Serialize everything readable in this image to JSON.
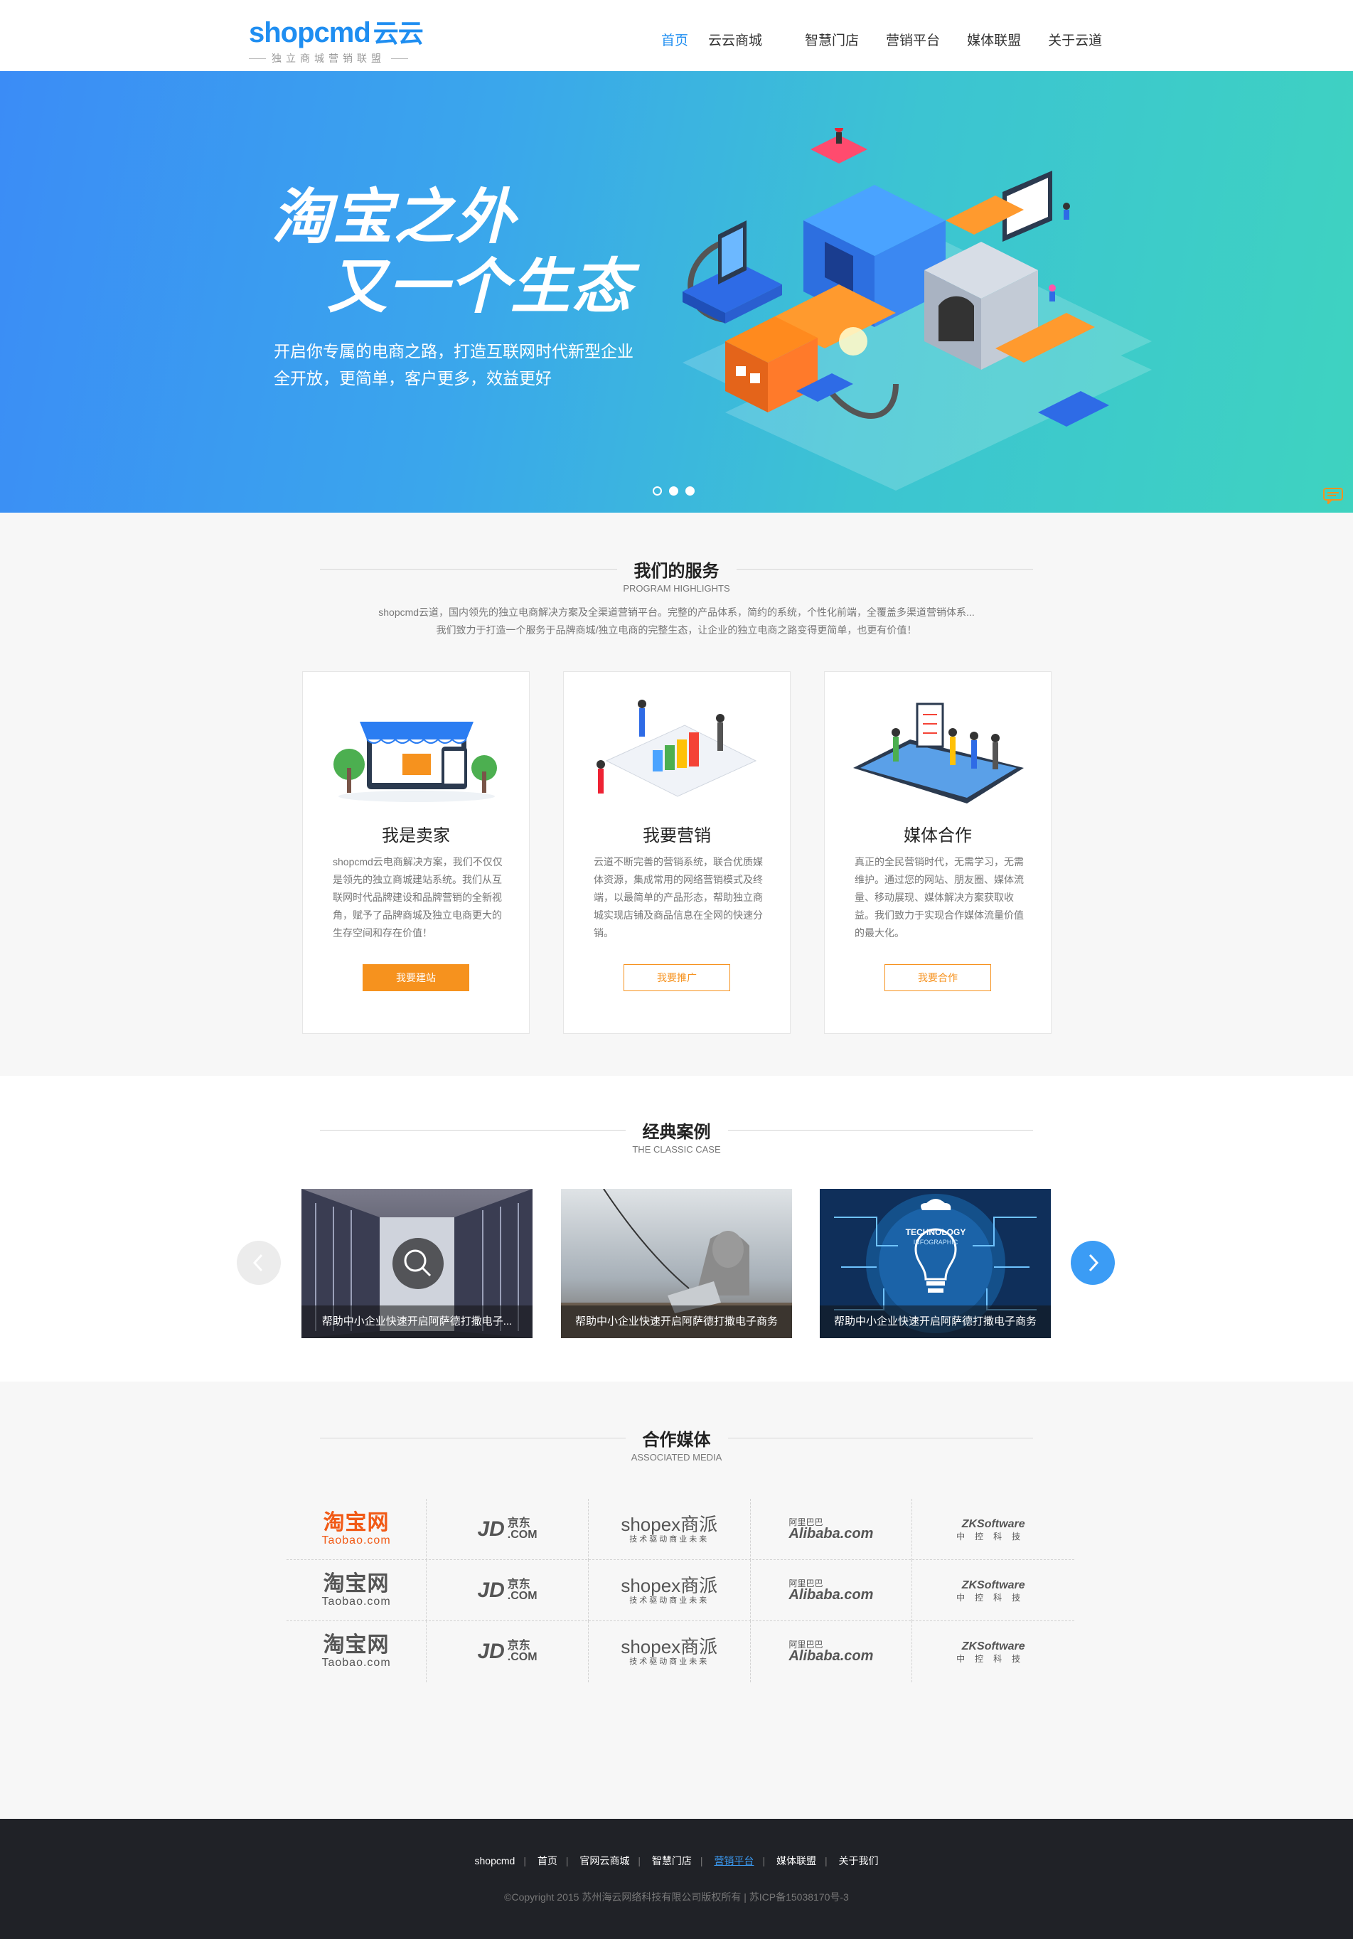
{
  "header": {
    "logo_text": "shopcmd",
    "logo_cn": "云云",
    "logo_tagline": "独立商城营销联盟",
    "nav": [
      {
        "label": "首页",
        "active": true
      },
      {
        "label": "云云商城",
        "active": false
      },
      {
        "label": "智慧门店",
        "active": false
      },
      {
        "label": "营销平台",
        "active": false
      },
      {
        "label": "媒体联盟",
        "active": false
      },
      {
        "label": "关于云道",
        "active": false
      }
    ]
  },
  "banner": {
    "title_line1": "淘宝之外",
    "title_line2": "又一个生态",
    "sub_line1": "开启你专属的电商之路，打造互联网时代新型企业",
    "sub_line2": "全开放，更简单，客户更多，效益更好",
    "slides": 3,
    "active_slide": 2
  },
  "services": {
    "title": "我们的服务",
    "subtitle": "PROGRAM HIGHLIGHTS",
    "desc_line1": "shopcmd云道，国内领先的独立电商解决方案及全渠道营销平台。完整的产品体系，简约的系统，个性化前端，全覆盖多渠道营销体系...",
    "desc_line2": "我们致力于打造一个服务于品牌商城/独立电商的完整生态，让企业的独立电商之路变得更简单，也更有价值！",
    "cards": [
      {
        "title": "我是卖家",
        "text": "shopcmd云电商解决方案，我们不仅仅是领先的独立商城建站系统。我们从互联网时代品牌建设和品牌营销的全新视角，赋予了品牌商城及独立电商更大的生存空间和存在价值！",
        "button": "我要建站"
      },
      {
        "title": "我要营销",
        "text": "云道不断完善的营销系统，联合优质媒体资源，集成常用的网络营销模式及终端，以最简单的产品形态，帮助独立商城实现店铺及商品信息在全网的快速分销。",
        "button": "我要推广"
      },
      {
        "title": "媒体合作",
        "text": "真正的全民营销时代，无需学习，无需维护。通过您的网站、朋友圈、媒体流量、移动展现、媒体解决方案获取收益。我们致力于实现合作媒体流量价值的最大化。",
        "button": "我要合作"
      }
    ]
  },
  "cases": {
    "title": "经典案例",
    "subtitle": "THE CLASSIC CASE",
    "items": [
      {
        "caption": "帮助中小企业快速开启阿萨德打撒电子..."
      },
      {
        "caption": "帮助中小企业快速开启阿萨德打撒电子商务"
      },
      {
        "caption": "帮助中小企业快速开启阿萨德打撒电子商务"
      }
    ],
    "tech_label1": "TECHNOLOGY",
    "tech_label2": "INFOGRAPHIC"
  },
  "media": {
    "title": "合作媒体",
    "subtitle": "ASSOCIATED MEDIA",
    "rows": 3,
    "taobao_a": "淘宝网",
    "taobao_b": "Taobao.com",
    "jd_a": "JD",
    "jd_b1": "京东",
    "jd_b2": ".COM",
    "shopex_a": "shopex商派",
    "shopex_b": "技术驱动商业未来",
    "ali_a": "阿里巴巴",
    "ali_b": "Alibaba.com",
    "zk_a": "ZKSoftware",
    "zk_b": "中控科技"
  },
  "footer": {
    "links": [
      {
        "label": "shopcmd",
        "current": false
      },
      {
        "label": "首页",
        "current": false
      },
      {
        "label": "官网云商城",
        "current": false
      },
      {
        "label": "智慧门店",
        "current": false
      },
      {
        "label": "营销平台",
        "current": true
      },
      {
        "label": "媒体联盟",
        "current": false
      },
      {
        "label": "关于我们",
        "current": false
      }
    ],
    "copyright": "©Copyright 2015 苏州海云网络科技有限公司版权所有 | 苏ICP备15038170号-3"
  }
}
